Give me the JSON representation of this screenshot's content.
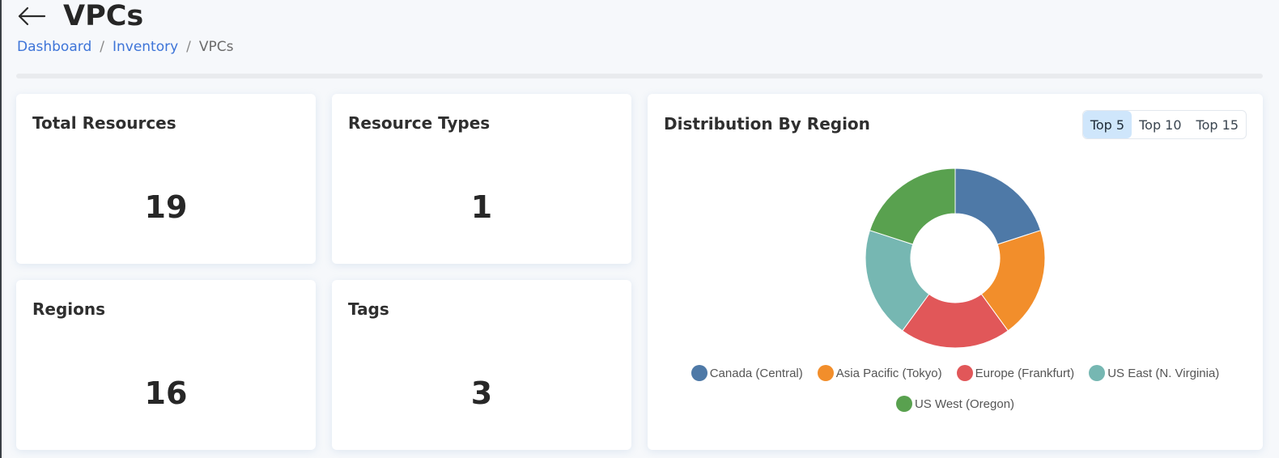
{
  "header": {
    "title": "VPCs",
    "back_icon": "arrow-left-icon"
  },
  "breadcrumb": {
    "items": [
      "Dashboard",
      "Inventory",
      "VPCs"
    ],
    "separator": "/"
  },
  "stats": {
    "total_resources": {
      "label": "Total Resources",
      "value": "19"
    },
    "resource_types": {
      "label": "Resource Types",
      "value": "1"
    },
    "regions": {
      "label": "Regions",
      "value": "16"
    },
    "tags": {
      "label": "Tags",
      "value": "3"
    }
  },
  "distribution": {
    "title": "Distribution By Region",
    "toggles": [
      "Top 5",
      "Top 10",
      "Top 15"
    ],
    "active_toggle": "Top 5"
  },
  "colors": {
    "link": "#3d74d8",
    "toggle_active": "#cfe6fb"
  },
  "chart_data": {
    "type": "pie",
    "donut": true,
    "title": "Distribution By Region",
    "categories": [
      "Canada (Central)",
      "Asia Pacific (Tokyo)",
      "Europe (Frankfurt)",
      "US East (N. Virginia)",
      "US West (Oregon)"
    ],
    "values": [
      1,
      1,
      1,
      1,
      1
    ],
    "colors": [
      "#4e79a7",
      "#f28e2b",
      "#e15759",
      "#76b7b2",
      "#59a14f"
    ],
    "legend_position": "bottom"
  }
}
